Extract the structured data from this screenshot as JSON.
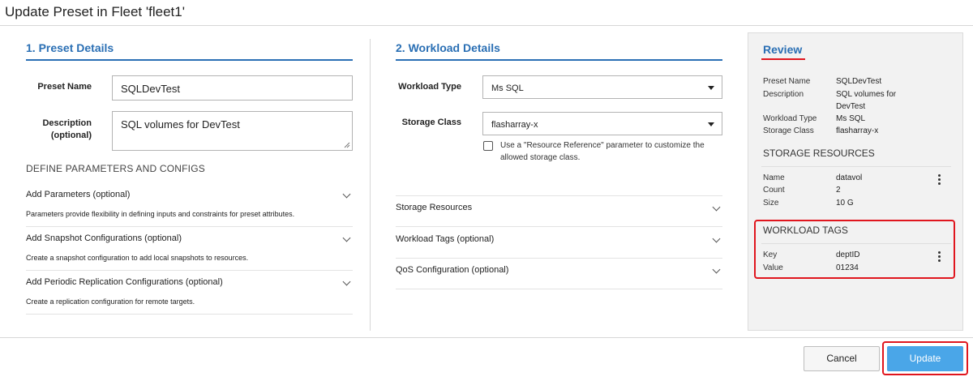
{
  "dialog": {
    "title": "Update Preset in Fleet 'fleet1'"
  },
  "preset_details": {
    "heading": "1. Preset Details",
    "name_label": "Preset Name",
    "name_value": "SQLDevTest",
    "desc_label_1": "Description",
    "desc_label_2": "(optional)",
    "desc_value": "SQL volumes for DevTest",
    "params_heading": "DEFINE PARAMETERS AND CONFIGS",
    "sections": [
      {
        "title": "Add Parameters (optional)",
        "desc": "Parameters provide flexibility in defining inputs and constraints for preset attributes."
      },
      {
        "title": "Add Snapshot Configurations (optional)",
        "desc": "Create a snapshot configuration to add local snapshots to resources."
      },
      {
        "title": "Add Periodic Replication Configurations (optional)",
        "desc": "Create a replication configuration for remote targets."
      }
    ]
  },
  "workload_details": {
    "heading": "2. Workload Details",
    "workload_type_label": "Workload Type",
    "workload_type_value": "Ms SQL",
    "storage_class_label": "Storage Class",
    "storage_class_value": "flasharray-x",
    "checkbox_line_1": "Use a \"Resource Reference\" parameter to customize the",
    "checkbox_line_2": "allowed storage class.",
    "sections": [
      {
        "title": "Storage Resources"
      },
      {
        "title": "Workload Tags (optional)"
      },
      {
        "title": "QoS Configuration (optional)"
      }
    ]
  },
  "review": {
    "heading": "Review",
    "preset_name_label": "Preset Name",
    "preset_name_value": "SQLDevTest",
    "description_label": "Description",
    "description_value_1": "SQL volumes for",
    "description_value_2": "DevTest",
    "workload_type_label": "Workload Type",
    "workload_type_value": "Ms SQL",
    "storage_class_label": "Storage Class",
    "storage_class_value": "flasharray-x",
    "storage_resources_heading": "STORAGE RESOURCES",
    "resource": {
      "name_label": "Name",
      "name_value": "datavol",
      "count_label": "Count",
      "count_value": "2",
      "size_label": "Size",
      "size_value": "10 G"
    },
    "workload_tags_heading": "WORKLOAD TAGS",
    "tag": {
      "key_label": "Key",
      "key_value": "deptID",
      "value_label": "Value",
      "value_value": "01234"
    }
  },
  "footer": {
    "cancel_label": "Cancel",
    "update_label": "Update"
  },
  "colors": {
    "accent": "#2a6fb4",
    "highlight": "#e0161e",
    "primary_button": "#4aa6e8"
  }
}
